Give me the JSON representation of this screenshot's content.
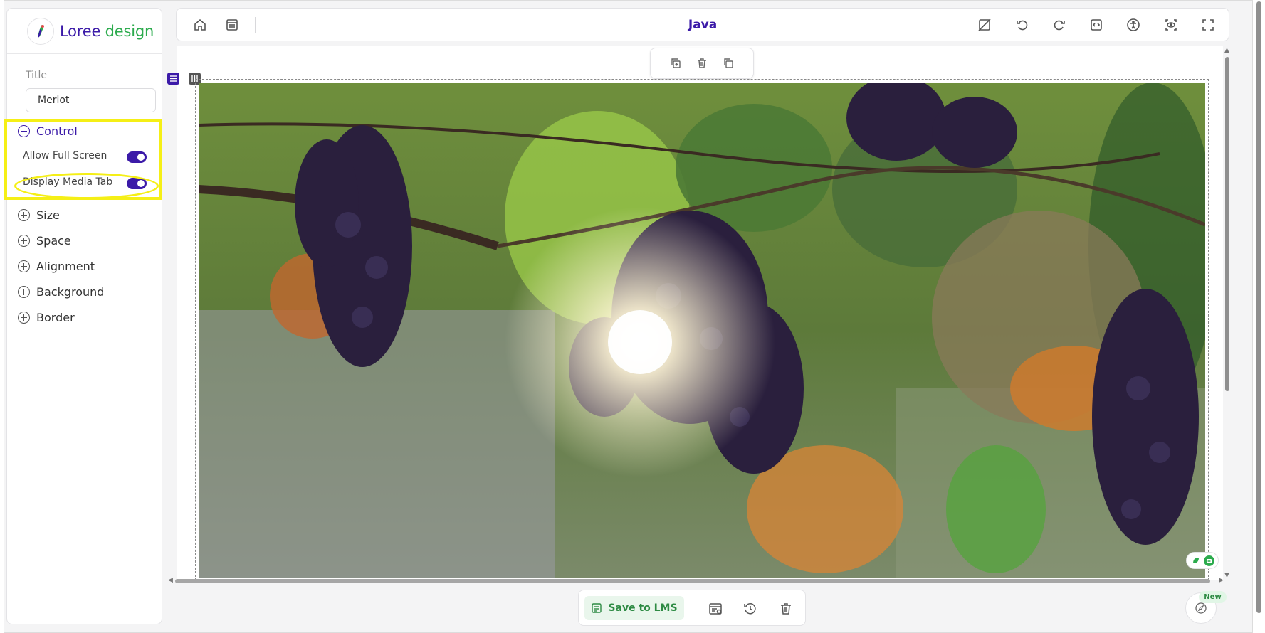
{
  "brand": {
    "name_part1": "Loree",
    "name_part2": " design"
  },
  "sidebar": {
    "title_label": "Title",
    "title_value": "Merlot",
    "control": {
      "label": "Control",
      "options": [
        {
          "label": "Allow Full Screen",
          "enabled": true
        },
        {
          "label": "Display Media Tab",
          "enabled": true
        }
      ]
    },
    "sections": [
      {
        "label": "Size"
      },
      {
        "label": "Space"
      },
      {
        "label": "Alignment"
      },
      {
        "label": "Background"
      },
      {
        "label": "Border"
      }
    ]
  },
  "topbar": {
    "document_title": "Java"
  },
  "bottombar": {
    "save_label": "Save to LMS"
  },
  "help": {
    "new_badge": "New"
  },
  "colors": {
    "brand_purple": "#3b1aa8",
    "brand_green": "#2cab4d",
    "highlight_yellow": "#f5ef16"
  }
}
